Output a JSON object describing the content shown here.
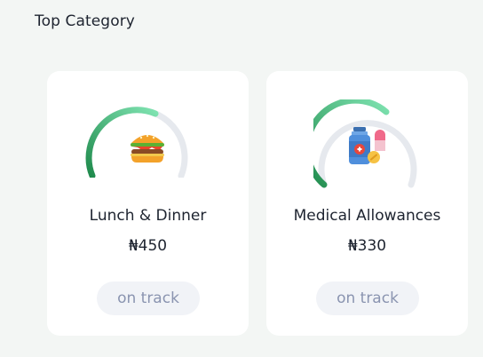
{
  "section": {
    "title": "Top Category"
  },
  "cards": [
    {
      "name": "Lunch & Dinner",
      "amount": "₦450",
      "status": "on track",
      "icon": "burger-icon",
      "progress": 0.58
    },
    {
      "name": "Medical Allowances",
      "amount": "₦330",
      "status": "on track",
      "icon": "medicine-icon",
      "progress": 0.62
    }
  ],
  "colors": {
    "page_bg": "#f3f6f4",
    "card_bg": "#ffffff",
    "gauge_track": "#e6e9ee",
    "gauge_start": "#1f8a4c",
    "gauge_end": "#7fe3b1",
    "pill_bg": "#f1f3f7",
    "pill_text": "#8a94b0"
  }
}
